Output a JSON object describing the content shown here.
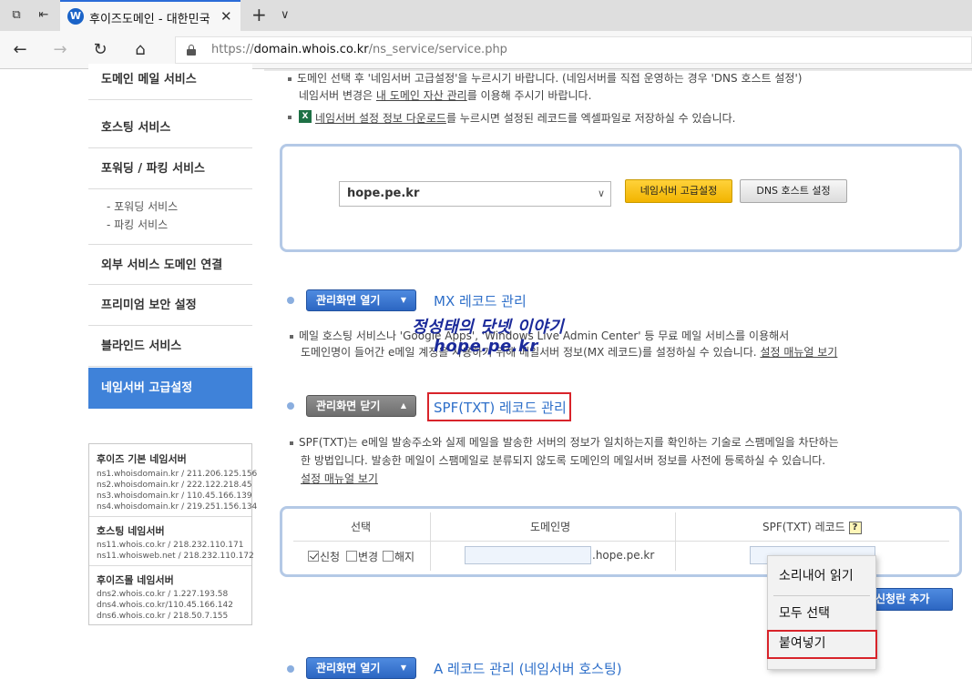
{
  "browser": {
    "tab_title": "후이즈도메인 - 대한민국",
    "favicon_letter": "W",
    "url_prefix": "https://",
    "url_host": "domain.whois.co.kr",
    "url_path": "/ns_service/service.php"
  },
  "sidebar": {
    "items": [
      {
        "label": "도메인 메일 서비스"
      },
      {
        "label": "호스팅 서비스"
      },
      {
        "label": "포워딩 / 파킹 서비스"
      },
      {
        "label": "외부 서비스 도메인 연결"
      },
      {
        "label": "프리미엄 보안 설정"
      },
      {
        "label": "블라인드 서비스"
      },
      {
        "label": "네임서버 고급설정"
      }
    ],
    "sub_items": [
      "- 포워딩 서비스",
      "- 파킹 서비스"
    ],
    "ns_groups": [
      {
        "title": "후이즈 기본 네임서버",
        "lines": [
          "ns1.whoisdomain.kr / 211.206.125.156",
          "ns2.whoisdomain.kr / 222.122.218.45",
          "ns3.whoisdomain.kr / 110.45.166.139",
          "ns4.whoisdomain.kr / 219.251.156.134"
        ]
      },
      {
        "title": "호스팅 네임서버",
        "lines": [
          "ns11.whois.co.kr / 218.232.110.171",
          "ns11.whoisweb.net / 218.232.110.172"
        ]
      },
      {
        "title": "후이즈몰 네임서버",
        "lines": [
          "dns2.whois.co.kr / 1.227.193.58",
          "dns4.whois.co.kr/110.45.166.142",
          "dns6.whois.co.kr / 218.50.7.155"
        ]
      }
    ]
  },
  "notice": {
    "line1": "도메인 선택 후 '네임서버 고급설정'을 누르시기 바랍니다. (네임서버를 직접 운영하는 경우 'DNS 호스트 설정')",
    "line2_pre": "네임서버 변경은 ",
    "line2_link": "내 도메인 자산 관리",
    "line2_post": "를 이용해 주시기 바랍니다.",
    "line3_link": "네임서버 설정 정보 다운로드",
    "line3_post": "를 누르시면 설정된 레코드를 엑셀파일로 저장하실 수 있습니다.",
    "excel_letter": "X"
  },
  "domain_selector": {
    "selected": "hope.pe.kr",
    "ns_adv_label": "네임서버 고급설정",
    "dns_host_label": "DNS 호스트 설정"
  },
  "mx": {
    "button": "관리화면 열기",
    "title": "MX 레코드 관리",
    "desc1": "메일 호스팅 서비스나 'Google Apps', 'Windows Live Admin Center' 등 무료 메일 서비스를 이용해서",
    "desc2": "도메인명이 들어간 e메일 계정을 사용하기 위해 메일서버 정보(MX 레코드)를 설정하실 수 있습니다. ",
    "desc2_link": "설정 매뉴얼 보기"
  },
  "watermark": {
    "line1": "정성태의 닷넷 이야기",
    "line2": "hope.pe.kr"
  },
  "spf": {
    "button": "관리화면 닫기",
    "title": "SPF(TXT) 레코드 관리",
    "desc1": "SPF(TXT)는 e메일 발송주소와 실제 메일을 발송한 서버의 정보가 일치하는지를 확인하는 기술로 스팸메일을 차단하는",
    "desc2": "한 방법입니다. 발송한 메일이 스팸메일로 분류되지 않도록 도메인의 메일서버 정보를 사전에 등록하실 수 있습니다.",
    "desc_link": "설정 매뉴얼 보기",
    "col_select": "선택",
    "col_domain": "도메인명",
    "col_record": "SPF(TXT) 레코드",
    "help": "?",
    "opt_apply": "신청",
    "opt_change": "변경",
    "opt_cancel": "해지",
    "domain_suffix": ".hope.pe.kr",
    "add_row": "신청란 추가"
  },
  "next_section": {
    "button": "관리화면 열기",
    "title": "A 레코드 관리 (네임서버 호스팅)"
  },
  "context_menu": {
    "items": [
      "소리내어 읽기",
      "모두 선택",
      "붙여넣기"
    ]
  },
  "colors": {
    "accent": "#3f82d9",
    "highlight": "#d8232a",
    "panel_border": "#b4c9e6",
    "link": "#2e6fc9"
  }
}
